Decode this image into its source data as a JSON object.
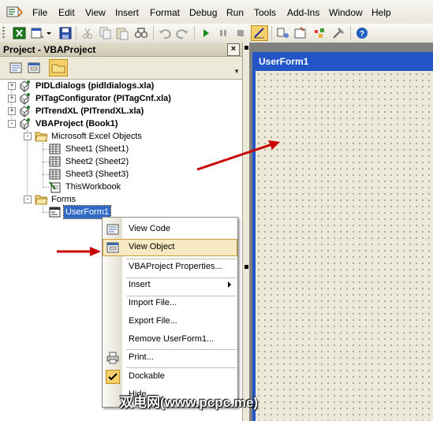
{
  "menubar": {
    "items": [
      {
        "label": "File"
      },
      {
        "label": "Edit"
      },
      {
        "label": "View"
      },
      {
        "label": "Insert"
      },
      {
        "label": "Format"
      },
      {
        "label": "Debug"
      },
      {
        "label": "Run"
      },
      {
        "label": "Tools"
      },
      {
        "label": "Add-Ins"
      },
      {
        "label": "Window"
      },
      {
        "label": "Help"
      }
    ]
  },
  "project": {
    "title": "Project - VBAProject",
    "close_glyph": "×"
  },
  "tree": {
    "nodes": [
      {
        "label": "PIDLdialogs (pidldialogs.xla)",
        "expander": "+"
      },
      {
        "label": "PITagConfigurator (PITagCnf.xla)",
        "expander": "+"
      },
      {
        "label": "PITrendXL (PITrendXL.xla)",
        "expander": "+"
      },
      {
        "label": "VBAProject (Book1)",
        "expander": "-"
      },
      {
        "label": "Microsoft Excel Objects",
        "expander": "-"
      },
      {
        "label": "Sheet1 (Sheet1)"
      },
      {
        "label": "Sheet2 (Sheet2)"
      },
      {
        "label": "Sheet3 (Sheet3)"
      },
      {
        "label": "ThisWorkbook"
      },
      {
        "label": "Forms",
        "expander": "-"
      },
      {
        "label": "UserForm1"
      }
    ]
  },
  "form": {
    "caption": "UserForm1"
  },
  "context_menu": {
    "items": [
      {
        "label": "View Code",
        "icon": "view-code-icon"
      },
      {
        "label": "View Object",
        "icon": "view-object-icon",
        "highlighted": true
      },
      {
        "label": "VBAProject Properties..."
      },
      {
        "label": "Insert",
        "submenu": true
      },
      {
        "label": "Import File..."
      },
      {
        "label": "Export File..."
      },
      {
        "label": "Remove UserForm1..."
      },
      {
        "label": "Print...",
        "icon": "printer-icon"
      },
      {
        "label": "Dockable",
        "icon": "checkmark-icon"
      },
      {
        "label": "Hide"
      }
    ]
  },
  "watermark": "双电网(www.pcpc.me)",
  "colors": {
    "selection": "#316ac5",
    "form_titlebar": "#2355c7",
    "arrow": "#c80000",
    "menu_highlight": "#f7e9c1"
  }
}
